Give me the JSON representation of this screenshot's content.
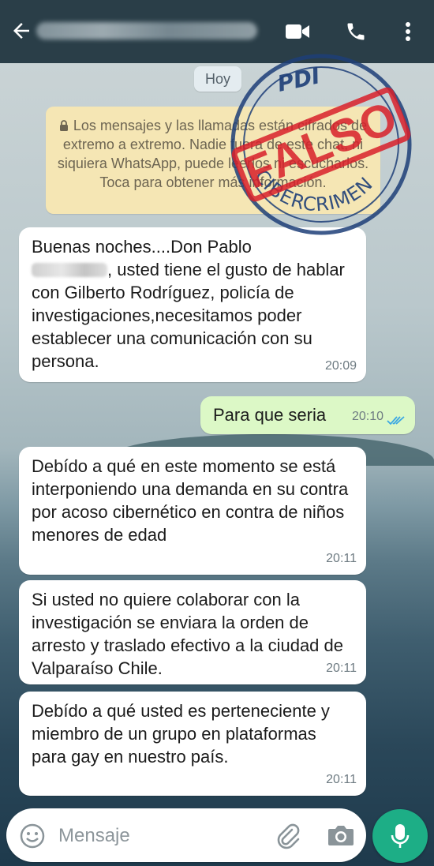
{
  "header": {
    "back_icon": "arrow-left-icon",
    "video_icon": "video-camera-icon",
    "call_icon": "phone-icon",
    "menu_icon": "more-vert-icon",
    "bar_color": "#2a3e48"
  },
  "chat": {
    "date_label": "Hoy",
    "encryption_notice": "Los mensajes y las llamadas están cifrados de extremo a extremo. Nadie fuera de este chat, ni siquiera WhatsApp, puede leerlos ni escucharlos. Toca para obtener más información.",
    "messages": [
      {
        "direction": "in",
        "text_before": "Buenas noches....Don Pablo",
        "text_after": ", usted tiene el gusto de hablar con Gilberto Rodríguez, policía de investigaciones,necesitamos poder establecer una comunicación con su persona.",
        "time": "20:09"
      },
      {
        "direction": "out",
        "text": "Para que seria",
        "time": "20:10",
        "status": "read"
      },
      {
        "direction": "in",
        "text": "Debído a qué en este momento se está interponiendo una demanda en su contra por acoso cibernético en contra de niños menores de edad",
        "time": "20:11"
      },
      {
        "direction": "in",
        "text": "Si usted no quiere colaborar con la investigación se enviara la orden de arresto y traslado efectivo a la ciudad de Valparaíso Chile.",
        "time": "20:11"
      },
      {
        "direction": "in",
        "text": "Debído a qué usted es perteneciente y miembro de un grupo en plataformas para gay en nuestro país.",
        "time": "20:11"
      }
    ]
  },
  "stamp": {
    "top_text": "PDI",
    "center_text": "FALSO",
    "bottom_text": "CIBERCRIMEN",
    "color": "#d8202a",
    "ring_color": "#1d3e78"
  },
  "composer": {
    "placeholder": "Mensaje",
    "emoji_icon": "emoji-icon",
    "attach_icon": "paperclip-icon",
    "camera_icon": "camera-icon",
    "mic_icon": "microphone-icon",
    "mic_color": "#1dae86"
  }
}
